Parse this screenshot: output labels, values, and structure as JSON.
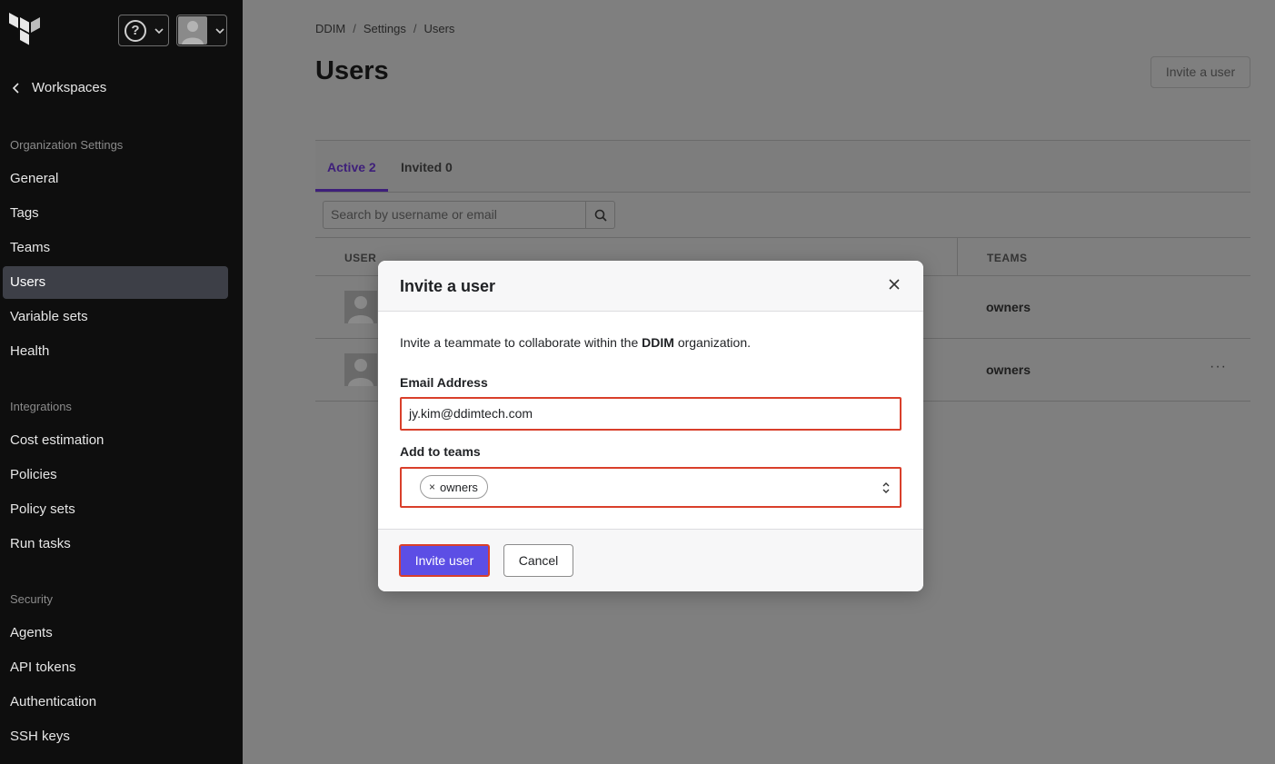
{
  "sidebar": {
    "back_label": "Workspaces",
    "sections": [
      {
        "title": "Organization Settings",
        "items": [
          "General",
          "Tags",
          "Teams",
          "Users",
          "Variable sets",
          "Health"
        ]
      },
      {
        "title": "Integrations",
        "items": [
          "Cost estimation",
          "Policies",
          "Policy sets",
          "Run tasks"
        ]
      },
      {
        "title": "Security",
        "items": [
          "Agents",
          "API tokens",
          "Authentication",
          "SSH keys"
        ]
      }
    ],
    "active_item": "Users"
  },
  "breadcrumb": [
    "DDIM",
    "Settings",
    "Users"
  ],
  "page": {
    "title": "Users",
    "invite_button": "Invite a user"
  },
  "tabs": [
    {
      "label": "Active 2",
      "active": true
    },
    {
      "label": "Invited 0",
      "active": false
    }
  ],
  "search": {
    "placeholder": "Search by username or email"
  },
  "table": {
    "headers": {
      "user": "USER",
      "teams": "TEAMS"
    },
    "rows": [
      {
        "team": "owners",
        "has_menu": false
      },
      {
        "team": "owners",
        "has_menu": true,
        "menu": "···"
      }
    ]
  },
  "modal": {
    "title": "Invite a user",
    "intro_prefix": "Invite a teammate to collaborate within the ",
    "intro_org": "DDIM",
    "intro_suffix": " organization.",
    "email_label": "Email Address",
    "email_value": "jy.kim@ddimtech.com",
    "teams_label": "Add to teams",
    "selected_teams": [
      "owners"
    ],
    "chip_remove": "×",
    "submit_label": "Invite user",
    "cancel_label": "Cancel"
  },
  "colors": {
    "primary": "#5c4ee5",
    "highlight_border": "#d93f2b",
    "sidebar_bg": "#0e0e0e",
    "active_tab": "#3e1f7a"
  }
}
